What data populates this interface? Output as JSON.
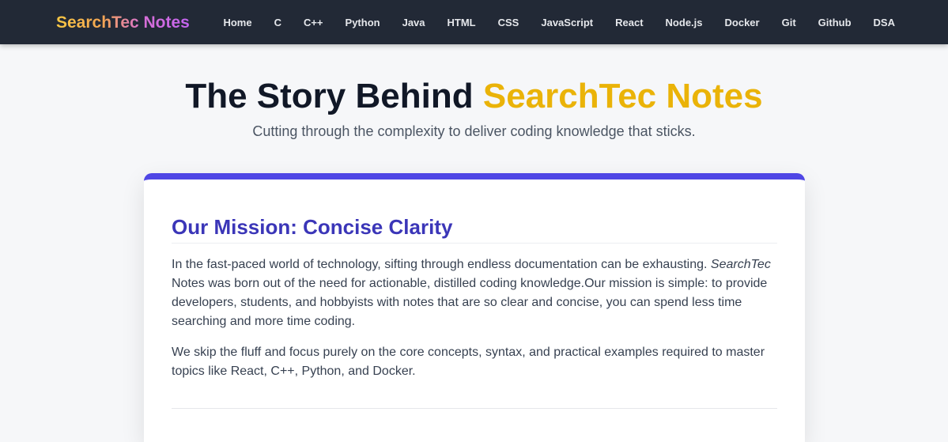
{
  "navbar": {
    "logo": "SearchTec Notes",
    "links": [
      "Home",
      "C",
      "C++",
      "Python",
      "Java",
      "HTML",
      "CSS",
      "JavaScript",
      "React",
      "Node.js",
      "Docker",
      "Git",
      "Github",
      "DSA"
    ]
  },
  "hero": {
    "title_main": "The Story Behind ",
    "title_accent": "SearchTec Notes",
    "subtitle": "Cutting through the complexity to deliver coding knowledge that sticks."
  },
  "mission": {
    "heading": "Our Mission: Concise Clarity",
    "p1_before": "In the fast-paced world of technology, sifting through endless documentation can be exhausting. ",
    "p1_italic": "SearchTec",
    "p1_after": " Notes was born out of the need for actionable, distilled coding knowledge.Our mission is simple: to provide developers, students, and hobbyists with notes that are so clear and concise, you can spend less time searching and more time coding.",
    "p2": "We skip the fluff and focus purely on the core concepts, syntax, and practical examples required to master topics like React, C++, Python, and Docker."
  },
  "colors": {
    "navbar_bg": "#222936",
    "accent_yellow": "#eab308",
    "mission_heading": "#3b36b8",
    "card_top_border": "#4f46e5"
  }
}
